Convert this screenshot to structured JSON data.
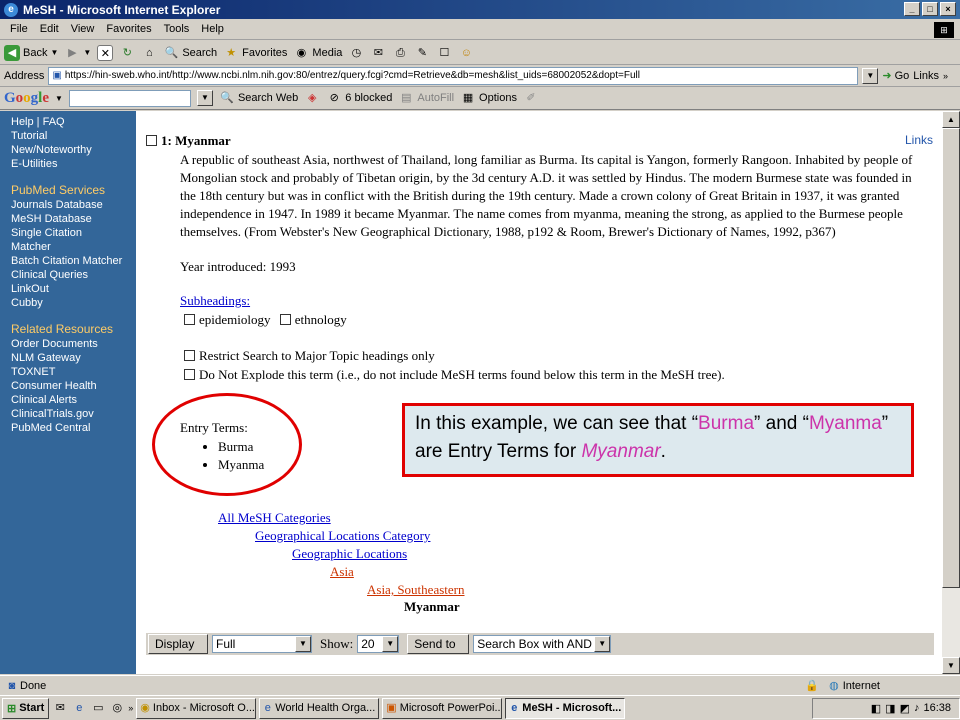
{
  "window": {
    "title": "MeSH - Microsoft Internet Explorer"
  },
  "menu": [
    "File",
    "Edit",
    "View",
    "Favorites",
    "Tools",
    "Help"
  ],
  "toolbar": {
    "back": "Back",
    "search": "Search",
    "favorites": "Favorites",
    "media": "Media"
  },
  "address": {
    "label": "Address",
    "url": "https://hin-sweb.who.int/http://www.ncbi.nlm.nih.gov:80/entrez/query.fcgi?cmd=Retrieve&db=mesh&list_uids=68002052&dopt=Full",
    "go": "Go",
    "links": "Links"
  },
  "google": {
    "logo": "Google",
    "search_web": "Search Web",
    "blocked": "6 blocked",
    "autofill": "AutoFill",
    "options": "Options"
  },
  "sidebar": {
    "top": [
      "Help | FAQ",
      "Tutorial",
      "New/Noteworthy",
      "E-Utilities"
    ],
    "pubmed_title": "PubMed Services",
    "pubmed": [
      "Journals Database",
      "MeSH Database",
      "Single Citation Matcher",
      "Batch Citation Matcher",
      "Clinical Queries",
      "LinkOut",
      "Cubby"
    ],
    "related_title": "Related Resources",
    "related": [
      "Order Documents",
      "NLM Gateway",
      "TOXNET",
      "Consumer Health",
      "Clinical Alerts",
      "ClinicalTrials.gov",
      "PubMed Central"
    ]
  },
  "record": {
    "heading": "1: Myanmar",
    "links": "Links",
    "description": "A republic of southeast Asia, northwest of Thailand, long familiar as Burma. Its capital is Yangon, formerly Rangoon. Inhabited by people of Mongolian stock and probably of Tibetan origin, by the 3d century A.D. it was settled by Hindus. The modern Burmese state was founded in the 18th century but was in conflict with the British during the 19th century. Made a crown colony of Great Britain in 1937, it was granted independence in 1947. In 1989 it became Myanmar. The name comes from myanma, meaning the strong, as applied to the Burmese people themselves. (From Webster's New Geographical Dictionary, 1988, p192 & Room, Brewer's Dictionary of Names, 1992, p367)",
    "year": "Year introduced: 1993",
    "subheadings_label": "Subheadings:",
    "subheadings": [
      "epidemiology",
      "ethnology"
    ],
    "restrict": "Restrict Search to Major Topic headings only",
    "explode": "Do Not Explode this term (i.e., do not include MeSH terms found below this term in the MeSH tree).",
    "entry_label": "Entry Terms:",
    "entry_terms": [
      "Burma",
      "Myanma"
    ],
    "tree": [
      "All MeSH Categories",
      "Geographical Locations Category",
      "Geographic Locations",
      "Asia",
      "Asia, Southeastern",
      "Myanmar"
    ]
  },
  "callout": {
    "p1": "In this example, we can see that “",
    "burma": "Burma",
    "p2": "” and “",
    "myanma": "Myanma",
    "p3": "” are Entry Terms for ",
    "myanmar": "Myanmar",
    "p4": "."
  },
  "footer": {
    "display": "Display",
    "format": "Full",
    "show_label": "Show:",
    "show_value": "20",
    "send": "Send to",
    "target": "Search Box with AND"
  },
  "status": {
    "text": "Done",
    "zone": "Internet"
  },
  "taskbar": {
    "start": "Start",
    "tasks": [
      "Inbox - Microsoft O...",
      "World Health Orga...",
      "Microsoft PowerPoi...",
      "MeSH - Microsoft..."
    ],
    "time": "16:38"
  },
  "colors": {
    "sidebar": "#336699",
    "section": "#ffcc66",
    "callout_border": "#e00000",
    "callout_bg": "#dde9ee",
    "highlight": "#cc33aa"
  }
}
